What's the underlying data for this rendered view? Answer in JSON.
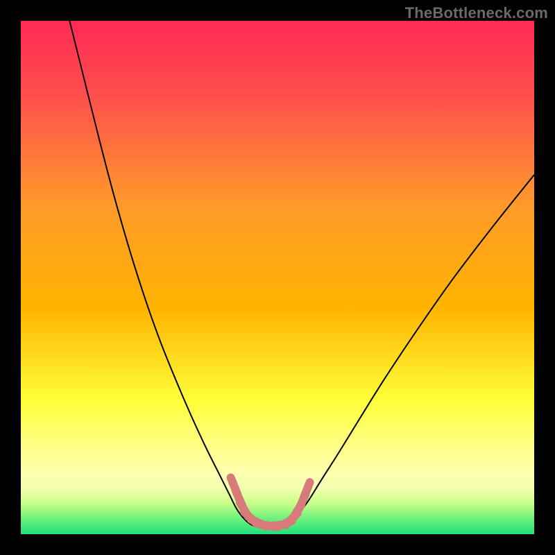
{
  "watermark": "TheBottleneck.com",
  "chart_data": {
    "type": "line",
    "title": "",
    "xlabel": "",
    "ylabel": "",
    "xlim": [
      0,
      100
    ],
    "ylim": [
      0,
      100
    ],
    "background_gradient": {
      "top": "#ff2a55",
      "mid_upper": "#ffb400",
      "mid_lower": "#ffff3a",
      "band": "#ffffb0",
      "bottom": "#1fe07a"
    },
    "series": [
      {
        "name": "curve",
        "stroke": "#000000",
        "stroke_width": 2,
        "points": [
          {
            "x": 9.5,
            "y": 100.0
          },
          {
            "x": 12.0,
            "y": 90.0
          },
          {
            "x": 15.0,
            "y": 78.0
          },
          {
            "x": 18.0,
            "y": 66.5
          },
          {
            "x": 21.0,
            "y": 56.0
          },
          {
            "x": 24.0,
            "y": 46.5
          },
          {
            "x": 27.0,
            "y": 38.0
          },
          {
            "x": 30.0,
            "y": 30.5
          },
          {
            "x": 33.0,
            "y": 23.5
          },
          {
            "x": 36.0,
            "y": 17.0
          },
          {
            "x": 38.5,
            "y": 12.0
          },
          {
            "x": 40.5,
            "y": 8.0
          },
          {
            "x": 42.0,
            "y": 5.0
          },
          {
            "x": 43.5,
            "y": 3.0
          },
          {
            "x": 45.0,
            "y": 1.8
          },
          {
            "x": 47.0,
            "y": 1.2
          },
          {
            "x": 49.0,
            "y": 1.1
          },
          {
            "x": 51.0,
            "y": 1.4
          },
          {
            "x": 52.5,
            "y": 2.2
          },
          {
            "x": 54.0,
            "y": 3.8
          },
          {
            "x": 56.0,
            "y": 6.5
          },
          {
            "x": 58.5,
            "y": 10.5
          },
          {
            "x": 62.0,
            "y": 16.0
          },
          {
            "x": 66.0,
            "y": 22.5
          },
          {
            "x": 71.0,
            "y": 30.5
          },
          {
            "x": 77.0,
            "y": 39.5
          },
          {
            "x": 84.0,
            "y": 49.5
          },
          {
            "x": 92.0,
            "y": 60.0
          },
          {
            "x": 100.0,
            "y": 70.0
          }
        ]
      },
      {
        "name": "highlight-dots",
        "stroke": "#d67a7a",
        "stroke_width": 12,
        "linecap": "round",
        "points": [
          {
            "x": 41.5,
            "y": 9.5
          },
          {
            "x": 42.5,
            "y": 7.0
          },
          {
            "x": 43.5,
            "y": 4.8
          },
          {
            "x": 44.7,
            "y": 3.2
          },
          {
            "x": 46.3,
            "y": 2.2
          },
          {
            "x": 48.0,
            "y": 1.7
          },
          {
            "x": 49.7,
            "y": 1.7
          },
          {
            "x": 51.3,
            "y": 2.0
          },
          {
            "x": 52.7,
            "y": 2.9
          },
          {
            "x": 53.8,
            "y": 4.4
          },
          {
            "x": 54.8,
            "y": 6.3
          },
          {
            "x": 55.7,
            "y": 8.6
          }
        ]
      }
    ]
  }
}
